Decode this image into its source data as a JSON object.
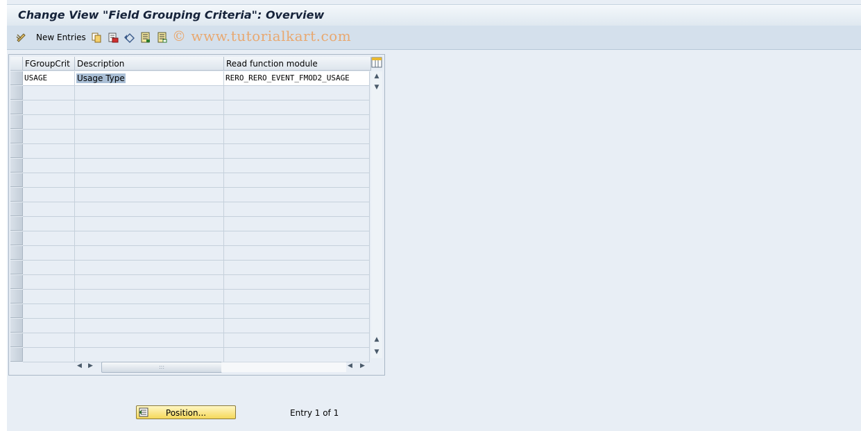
{
  "window": {
    "title": "Change View \"Field Grouping Criteria\": Overview"
  },
  "toolbar": {
    "new_entries_label": "New Entries",
    "icons": [
      "edit-pencil-icon",
      "copy-icon",
      "delete-icon",
      "undo-icon",
      "select-all-icon",
      "deselect-all-icon"
    ],
    "watermark": "© www.tutorialkart.com"
  },
  "table": {
    "columns": [
      "FGroupCrit",
      "Description",
      "Read function module"
    ],
    "rows": [
      {
        "fgroupcrit": "USAGE",
        "description": "Usage Type",
        "read_function_module": "RERO_RERO_EVENT_FMOD2_USAGE"
      }
    ],
    "visible_row_count": 20,
    "handle_glyph": ":::"
  },
  "footer": {
    "position_button_label": "Position...",
    "entry_text": "Entry 1 of 1"
  },
  "colors": {
    "background": "#e8eef5",
    "toolbar": "#d4e0ec",
    "selection": "#aabfd6",
    "button_yellow": "#f5d85a"
  }
}
